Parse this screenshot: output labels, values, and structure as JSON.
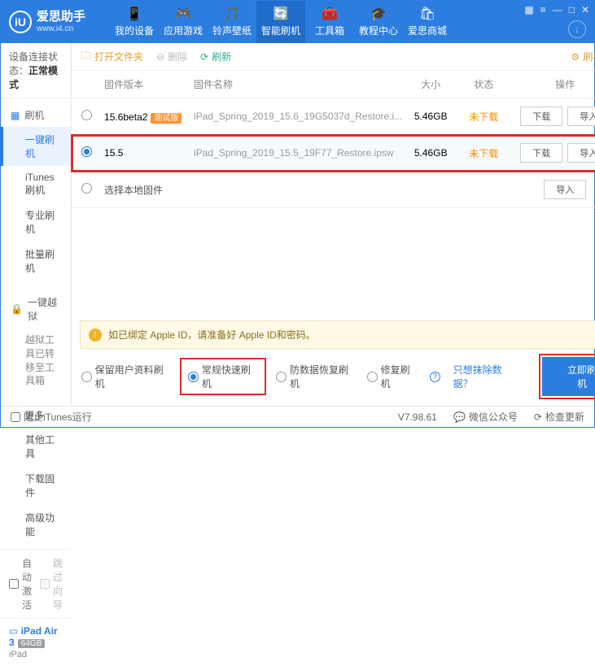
{
  "brand": {
    "cn": "爱思助手",
    "url": "www.i4.cn",
    "logo": "iU"
  },
  "nav": [
    {
      "label": "我的设备",
      "icon": "📱"
    },
    {
      "label": "应用游戏",
      "icon": "🎮"
    },
    {
      "label": "铃声壁纸",
      "icon": "🎵"
    },
    {
      "label": "智能刷机",
      "icon": "🔄",
      "active": true
    },
    {
      "label": "工具箱",
      "icon": "🧰"
    },
    {
      "label": "教程中心",
      "icon": "🎓"
    },
    {
      "label": "爱思商城",
      "icon": "🛍"
    }
  ],
  "winbtns": [
    "▦",
    "≡",
    "—",
    "□",
    "✕"
  ],
  "status": {
    "label": "设备连接状态：",
    "value": "正常模式"
  },
  "side": {
    "flash": {
      "head": "刷机",
      "items": [
        "一键刷机",
        "iTunes刷机",
        "专业刷机",
        "批量刷机"
      ]
    },
    "jail": {
      "head": "一键越狱",
      "note": "越狱工具已转移至工具箱"
    },
    "more": {
      "head": "更多",
      "items": [
        "其他工具",
        "下载固件",
        "高级功能"
      ]
    }
  },
  "checks": {
    "autoact": "自动激活",
    "skipguide": "跳过向导"
  },
  "device": {
    "name": "iPad Air 3",
    "cap": "64GB",
    "type": "iPad"
  },
  "toolbar": {
    "open": "打开文件夹",
    "del": "删除",
    "refresh": "刷新",
    "settings": "刷机设置"
  },
  "cols": {
    "ver": "固件版本",
    "name": "固件名称",
    "size": "大小",
    "status": "状态",
    "ops": "操作"
  },
  "rows": [
    {
      "ver": "15.6beta2",
      "badge": "测试版",
      "name": "iPad_Spring_2019_15.6_19G5037d_Restore.i...",
      "size": "5.46GB",
      "status": "未下载",
      "selected": false
    },
    {
      "ver": "15.5",
      "badge": "",
      "name": "iPad_Spring_2019_15.5_19F77_Restore.ipsw",
      "size": "5.46GB",
      "status": "未下载",
      "selected": true
    }
  ],
  "local": "选择本地固件",
  "btns": {
    "download": "下载",
    "import": "导入"
  },
  "notice": "如已绑定 Apple ID，请准备好 Apple ID和密码。",
  "modes": {
    "keep": "保留用户资料刷机",
    "normal": "常规快速刷机",
    "antidata": "防数据恢复刷机",
    "repair": "修复刷机"
  },
  "extra": {
    "onlyclear": "只想抹除数据？"
  },
  "primary": "立即刷机",
  "footer": {
    "block": "阻止iTunes运行",
    "ver": "V7.98.61",
    "wechat": "微信公众号",
    "update": "检查更新"
  }
}
